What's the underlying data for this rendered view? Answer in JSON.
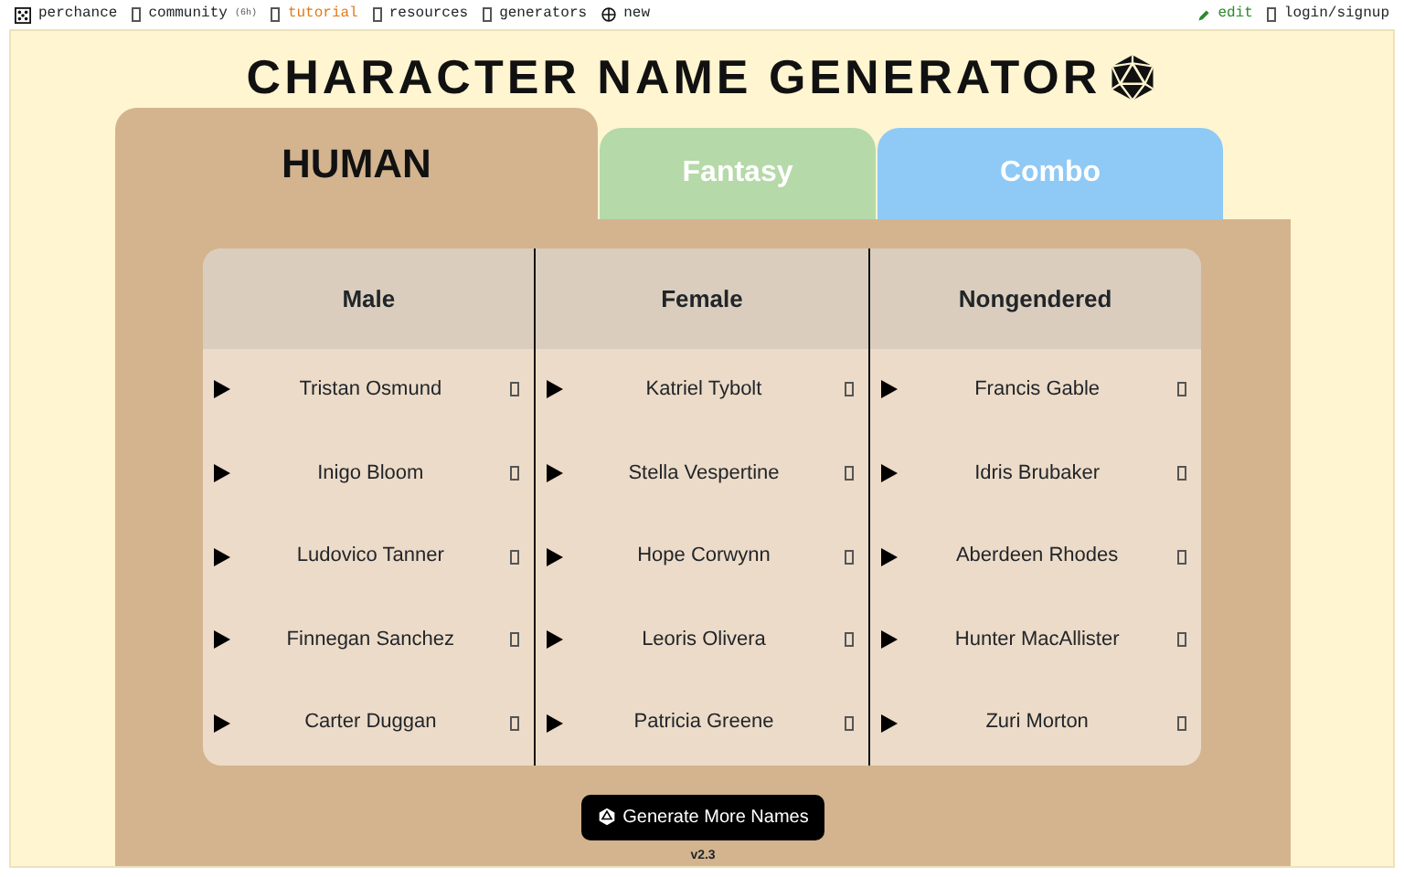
{
  "top_nav": {
    "left": [
      {
        "label": "perchance",
        "kind": "dice"
      },
      {
        "label": "community",
        "note": "(6h)",
        "kind": "glyph"
      },
      {
        "label": "tutorial",
        "kind": "glyph",
        "highlight": true
      },
      {
        "label": "resources",
        "kind": "glyph"
      },
      {
        "label": "generators",
        "kind": "glyph"
      },
      {
        "label": "new",
        "kind": "plus"
      }
    ],
    "right": [
      {
        "label": "edit",
        "kind": "pencil"
      },
      {
        "label": "login/signup",
        "kind": "glyph"
      }
    ]
  },
  "title": "CHARACTER NAME GENERATOR",
  "tabs": [
    {
      "label": "HUMAN",
      "selected": true,
      "color": "#d3b48f"
    },
    {
      "label": "Fantasy",
      "selected": false,
      "color": "#b5d9a8"
    },
    {
      "label": "Combo",
      "selected": false,
      "color": "#8fc9f5"
    }
  ],
  "columns": [
    {
      "heading": "Male",
      "names": [
        "Tristan Osmund",
        "Inigo Bloom",
        "Ludovico Tanner",
        "Finnegan Sanchez",
        "Carter Duggan"
      ]
    },
    {
      "heading": "Female",
      "names": [
        "Katriel Tybolt",
        "Stella Vespertine",
        "Hope Corwynn",
        "Leoris Olivera",
        "Patricia Greene"
      ]
    },
    {
      "heading": "Nongendered",
      "names": [
        "Francis Gable",
        "Idris Brubaker",
        "Aberdeen Rhodes",
        "Hunter MacAllister",
        "Zuri Morton"
      ]
    }
  ],
  "generate_button": "Generate More Names",
  "version": "v2.3"
}
